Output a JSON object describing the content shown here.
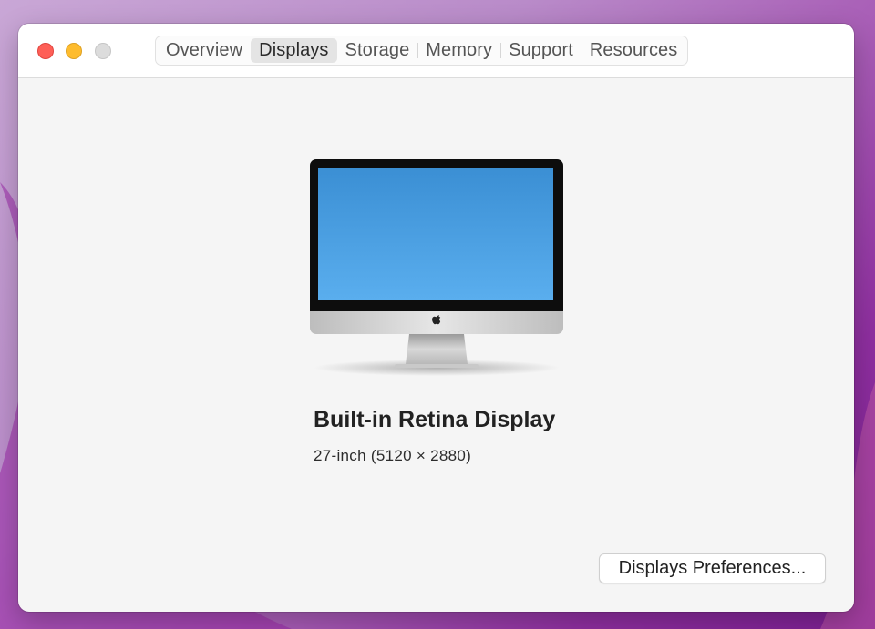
{
  "window": {
    "tabs": [
      {
        "label": "Overview"
      },
      {
        "label": "Displays"
      },
      {
        "label": "Storage"
      },
      {
        "label": "Memory"
      },
      {
        "label": "Support"
      },
      {
        "label": "Resources"
      }
    ],
    "selected_tab": "Displays"
  },
  "display": {
    "name": "Built-in Retina Display",
    "spec": "27-inch (5120 × 2880)",
    "icon": "imac-icon"
  },
  "actions": {
    "preferences_label": "Displays Preferences..."
  },
  "colors": {
    "close": "#fe5f57",
    "minimize": "#febc2e",
    "zoom": "#dcdcdc",
    "screen": "#4a9ee0"
  }
}
